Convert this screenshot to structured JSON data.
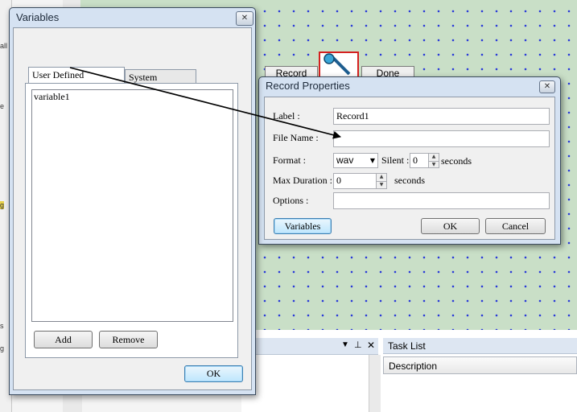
{
  "background": {
    "flow_nodes": {
      "record": "Record",
      "done": "Done"
    },
    "left_strip_fragments": [
      "all",
      "e",
      "g",
      "s",
      "g"
    ],
    "task_list": {
      "title": "Task List",
      "column": "Description"
    },
    "output_panel_controls": [
      "▼",
      "⊥",
      "✕"
    ]
  },
  "variables_window": {
    "title": "Variables",
    "close_glyph": "✕",
    "tabs": [
      "User Defined Variables",
      "System Variables"
    ],
    "items": [
      "variable1"
    ],
    "add_label": "Add",
    "remove_label": "Remove",
    "ok_label": "OK"
  },
  "record_window": {
    "title": "Record Properties",
    "close_glyph": "✕",
    "label_label": "Label :",
    "label_value": "Record1",
    "file_name_label": "File Name :",
    "file_name_value": "",
    "format_label": "Format :",
    "format_value": "wav",
    "silent_label": "Silent :",
    "silent_value": "0",
    "seconds_1": "seconds",
    "max_duration_label": "Max Duration :",
    "max_duration_value": "0",
    "seconds_2": "seconds",
    "options_label": "Options :",
    "options_value": "",
    "variables_button": "Variables",
    "ok_label": "OK",
    "cancel_label": "Cancel"
  },
  "colors": {
    "canvas": "#c9dfc7",
    "grid_dots": "#2a3ad8",
    "window_frame": "#d5e2f2",
    "selected_node_border": "#d42020"
  }
}
